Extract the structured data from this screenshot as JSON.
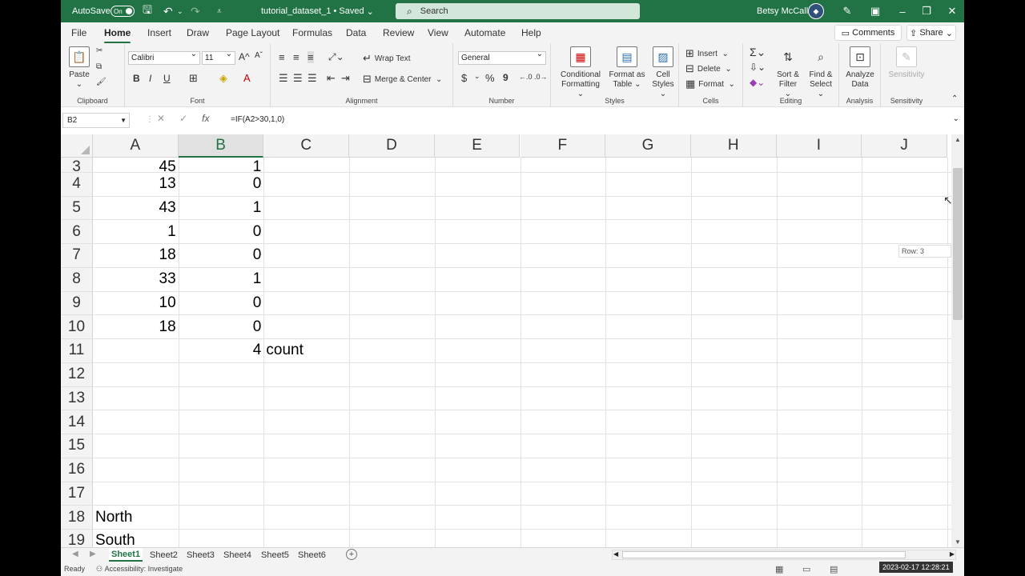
{
  "titlebar": {
    "autosave_label": "AutoSave",
    "autosave_state": "On",
    "document_title": "tutorial_dataset_1 • Saved",
    "search_placeholder": "Search",
    "user_name": "Betsy McCall",
    "accent_color": "#217346"
  },
  "menu": {
    "tabs": [
      "File",
      "Home",
      "Insert",
      "Draw",
      "Page Layout",
      "Formulas",
      "Data",
      "Review",
      "View",
      "Automate",
      "Help"
    ],
    "active_tab": "Home",
    "comments_label": "Comments",
    "share_label": "Share"
  },
  "ribbon": {
    "clipboard": {
      "label": "Clipboard",
      "paste": "Paste"
    },
    "font": {
      "label": "Font",
      "font_name": "Calibri",
      "font_size": "11",
      "bold": "B",
      "italic": "I",
      "underline": "U"
    },
    "alignment": {
      "label": "Alignment",
      "wrap_text": "Wrap Text",
      "merge_center": "Merge & Center"
    },
    "number": {
      "label": "Number",
      "format": "General",
      "currency": "$",
      "percent": "%",
      "comma": "9"
    },
    "styles": {
      "label": "Styles",
      "conditional": [
        "Conditional",
        "Formatting ⌄"
      ],
      "format_table": [
        "Format as",
        "Table ⌄"
      ],
      "cell_styles": [
        "Cell",
        "Styles ⌄"
      ]
    },
    "cells": {
      "label": "Cells",
      "insert": "Insert",
      "delete": "Delete",
      "format": "Format"
    },
    "editing": {
      "label": "Editing",
      "sort_filter": [
        "Sort &",
        "Filter ⌄"
      ],
      "find_select": [
        "Find &",
        "Select ⌄"
      ]
    },
    "analysis": {
      "label": "Analysis",
      "analyze": [
        "Analyze",
        "Data"
      ]
    },
    "sensitivity": {
      "label": "Sensitivity",
      "button": "Sensitivity"
    }
  },
  "formula_bar": {
    "name_box": "B2",
    "cancel": "✕",
    "enter": "✓",
    "fx": "fx",
    "formula": "=IF(A2>30,1,0)"
  },
  "grid": {
    "columns": [
      "A",
      "B",
      "C",
      "D",
      "E",
      "F",
      "G",
      "H",
      "I",
      "J"
    ],
    "selected_column": "B",
    "rows": [
      {
        "row": "3",
        "a": "45",
        "b": "1",
        "c": ""
      },
      {
        "row": "4",
        "a": "13",
        "b": "0",
        "c": ""
      },
      {
        "row": "5",
        "a": "43",
        "b": "1",
        "c": ""
      },
      {
        "row": "6",
        "a": "1",
        "b": "0",
        "c": ""
      },
      {
        "row": "7",
        "a": "18",
        "b": "0",
        "c": ""
      },
      {
        "row": "8",
        "a": "33",
        "b": "1",
        "c": ""
      },
      {
        "row": "9",
        "a": "10",
        "b": "0",
        "c": ""
      },
      {
        "row": "10",
        "a": "18",
        "b": "0",
        "c": ""
      },
      {
        "row": "11",
        "a": "",
        "b": "4",
        "c": "count"
      },
      {
        "row": "12",
        "a": "",
        "b": "",
        "c": ""
      },
      {
        "row": "13",
        "a": "",
        "b": "",
        "c": ""
      },
      {
        "row": "14",
        "a": "",
        "b": "",
        "c": ""
      },
      {
        "row": "15",
        "a": "",
        "b": "",
        "c": ""
      },
      {
        "row": "16",
        "a": "",
        "b": "",
        "c": ""
      },
      {
        "row": "17",
        "a": "",
        "b": "",
        "c": ""
      },
      {
        "row": "18",
        "a": "North",
        "b": "",
        "c": ""
      },
      {
        "row": "19",
        "a": "South",
        "b": "",
        "c": ""
      }
    ],
    "row_tooltip": "Row: 3"
  },
  "sheets": {
    "tabs": [
      "Sheet1",
      "Sheet2",
      "Sheet3",
      "Sheet4",
      "Sheet5",
      "Sheet6"
    ],
    "active": "Sheet1",
    "add": "+"
  },
  "status": {
    "ready": "Ready",
    "accessibility": "Accessibility: Investigate",
    "timestamp": "2023-02-17 12:28:21"
  }
}
